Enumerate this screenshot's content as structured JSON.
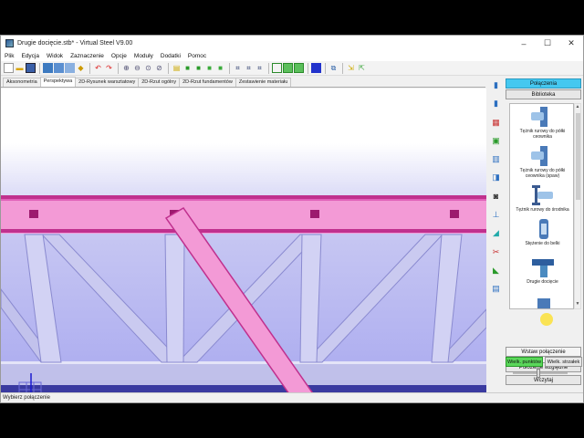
{
  "window": {
    "title": "Drugie docięcie.stb* - Virtual Steel V9.00",
    "controls": {
      "minimize": "–",
      "maximize": "☐",
      "close": "✕"
    }
  },
  "menu": [
    "Plik",
    "Edycja",
    "Widok",
    "Zaznaczenie",
    "Opcje",
    "Moduły",
    "Dodatki",
    "Pomoc"
  ],
  "view_tabs": [
    {
      "label": "Aksonometria",
      "active": false
    },
    {
      "label": "Perspektywa",
      "active": true
    },
    {
      "label": "2D-Rysunek warsztatowy",
      "active": false
    },
    {
      "label": "2D-Rzut ogólny",
      "active": false
    },
    {
      "label": "2D-Rzut fundamentów",
      "active": false
    },
    {
      "label": "Zestawienie materiału",
      "active": false
    }
  ],
  "right_panel": {
    "header": "Połączenia",
    "library_button": "Biblioteka",
    "library_items": [
      {
        "label": "Tężnik rurowy do półki ceownika",
        "icon": "pipe-brace-channel-flange-icon"
      },
      {
        "label": "Tężnik rurowy do półki ceownika (spaw)",
        "icon": "pipe-brace-channel-flange-weld-icon"
      },
      {
        "label": "Tężnik rurowy do środnika",
        "icon": "pipe-brace-web-icon"
      },
      {
        "label": "Stężenie do belki",
        "icon": "beam-bracing-icon"
      },
      {
        "label": "Drugie docięcie",
        "icon": "second-cut-icon"
      }
    ],
    "insert_button": "Wstaw połączenie",
    "position_button": "Położenie względne",
    "load_button": "Wczytaj",
    "point_size_button": "Wielk. punktów",
    "arrow_size_button": "Wielk. strzałek"
  },
  "status": {
    "text": "Wybierz połączenie"
  },
  "colors": {
    "beam": "#f39ad6",
    "beam_dark": "#c0308e",
    "plate": "#9c1a6e",
    "web": "#c8c8ee",
    "web_dark": "#8a8ad0",
    "panel_header": "#45c8f0",
    "toggle_green": "#5ad75a"
  }
}
